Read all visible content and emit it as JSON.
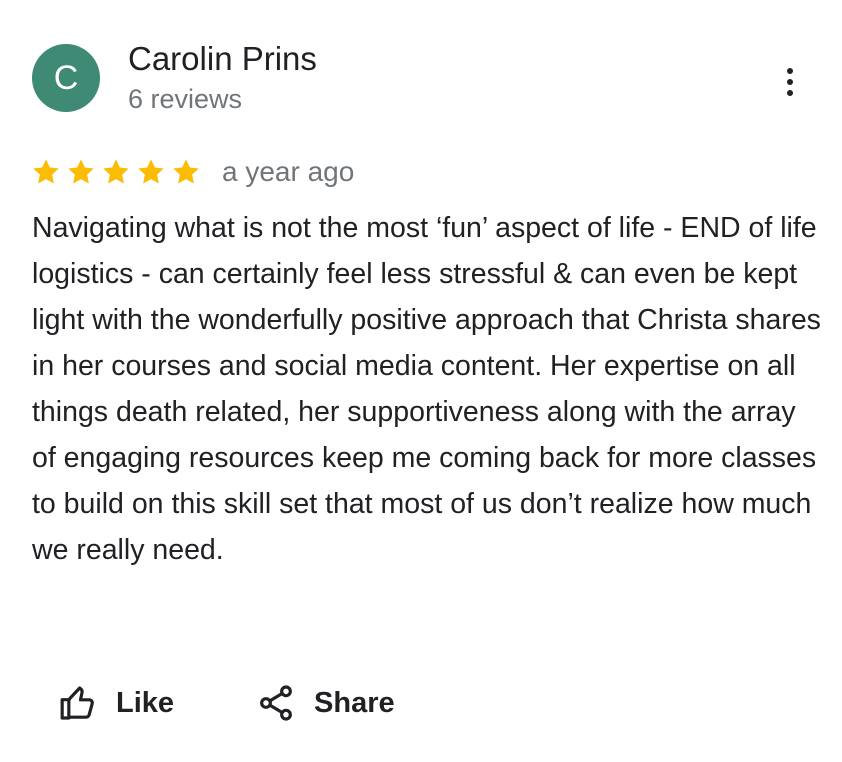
{
  "review": {
    "author": {
      "initial": "C",
      "name": "Carolin Prins",
      "reviews_count": "6 reviews",
      "avatar_color": "#3f8a74"
    },
    "rating": 5,
    "rating_max": 5,
    "star_color": "#fbbc04",
    "date": "a year ago",
    "text": "Navigating what is not the most ‘fun’ aspect of life - END of life logistics - can certainly feel less stressful & can even be kept light with the wonderfully positive approach that Christa shares in her courses and social media content. Her expertise on all things death related, her supportiveness along with the array of engaging resources keep me coming back for more classes to build on this skill set that most of us don’t realize how much we really need."
  },
  "menu": {
    "icon": "more-vert-icon"
  },
  "actions": {
    "like_label": "Like",
    "like_icon": "thumb-up-icon",
    "share_label": "Share",
    "share_icon": "share-icon"
  }
}
